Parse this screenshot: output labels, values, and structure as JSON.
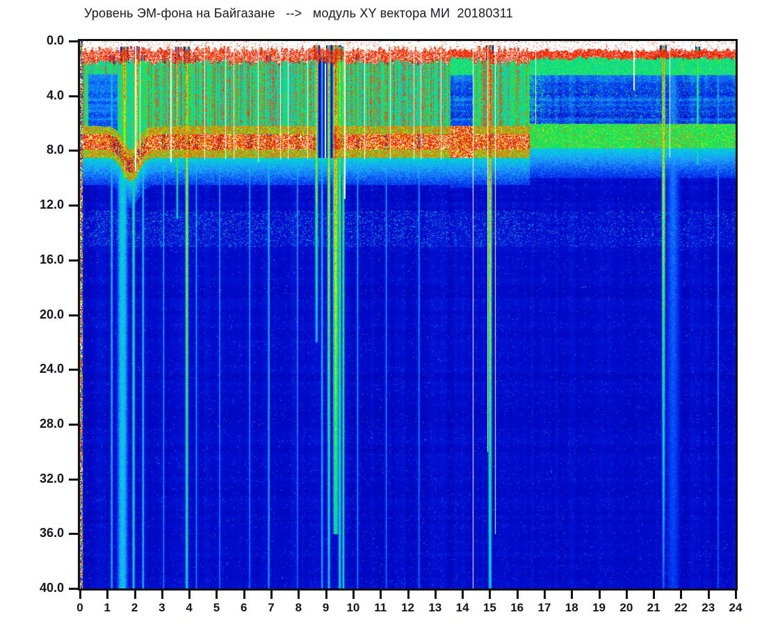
{
  "header": {
    "title": "Уровень ЭМ-фона на Байгазане   -->   модуль XY вектора МИ  20180311"
  },
  "chart_data": {
    "type": "heatmap",
    "title": "Уровень ЭМ-фона на Байгазане   -->   модуль XY вектора МИ  20180311",
    "date": "20180311",
    "station": "Байгазан",
    "quantity": "модуль XY вектора МИ",
    "x_axis": {
      "min": 0,
      "max": 24,
      "unit": "hour",
      "ticks": [
        "0",
        "1",
        "2",
        "3",
        "4",
        "5",
        "6",
        "7",
        "8",
        "9",
        "10",
        "11",
        "12",
        "13",
        "14",
        "15",
        "16",
        "17",
        "18",
        "19",
        "20",
        "21",
        "22",
        "23",
        "24"
      ]
    },
    "y_axis": {
      "min": 0,
      "max": 40,
      "inverted": true,
      "ticks": [
        "0.0",
        "4.0",
        "8.0",
        "12.0",
        "16.0",
        "20.0",
        "24.0",
        "28.0",
        "32.0",
        "36.0",
        "40.0"
      ]
    },
    "colors": {
      "background": "#ffffff",
      "frame": "#101010",
      "label": "#14141f",
      "deep_blue": "#000ac8",
      "cyan": "#00d0e4",
      "green": "#40e828",
      "yellow": "#ffe800",
      "red": "#ff3810"
    },
    "palette_stops": [
      [
        0.0,
        [
          0,
          0,
          168
        ]
      ],
      [
        0.06,
        [
          0,
          12,
          204
        ]
      ],
      [
        0.14,
        [
          0,
          64,
          246
        ]
      ],
      [
        0.22,
        [
          36,
          144,
          255
        ]
      ],
      [
        0.3,
        [
          0,
          208,
          228
        ]
      ],
      [
        0.4,
        [
          0,
          226,
          120
        ]
      ],
      [
        0.5,
        [
          64,
          232,
          40
        ]
      ],
      [
        0.6,
        [
          184,
          236,
          0
        ]
      ],
      [
        0.68,
        [
          255,
          232,
          0
        ]
      ],
      [
        0.76,
        [
          255,
          148,
          0
        ]
      ],
      [
        0.84,
        [
          255,
          56,
          16
        ]
      ],
      [
        1.0,
        [
          214,
          0,
          0
        ]
      ]
    ],
    "structure": {
      "regions": [
        {
          "t0": 0.0,
          "t1": 13.55,
          "mode": "active"
        },
        {
          "t0": 13.55,
          "t1": 14.38,
          "mode": "quiet"
        },
        {
          "t0": 14.38,
          "t1": 15.7,
          "mode": "active"
        },
        {
          "t0": 15.7,
          "t1": 16.45,
          "mode": "active_fading"
        },
        {
          "t0": 16.45,
          "t1": 24.01,
          "mode": "quiet"
        }
      ],
      "sparse_zones": [
        [
          8.62,
          9.26
        ]
      ],
      "blue_patches": [
        {
          "t0": 0.3,
          "t1": 1.35,
          "d0": 2.4,
          "d1": 6.6
        }
      ],
      "band": {
        "active_center": 7.35,
        "active_halfwidth": 1.15,
        "dip_center_t": 1.85,
        "dip_amount": 1.7,
        "dip_sigma": 0.4,
        "quiet_center": 6.9,
        "quiet_halfwidth": 0.9,
        "quiet_fleck_zones": [
          [
            20.3,
            22.4
          ]
        ]
      },
      "red_stripe_zones": [
        [
          0.1,
          1.4,
          0.18
        ],
        [
          2.35,
          8.6,
          0.42
        ],
        [
          9.7,
          13.5,
          0.4
        ],
        [
          14.45,
          15.65,
          0.5
        ],
        [
          15.65,
          16.4,
          0.22
        ]
      ],
      "speckle_band": {
        "d0": 12.4,
        "d1": 15.0,
        "chance_active": 0.09,
        "chance_quiet": 0.05
      },
      "deep_streaks": [
        [
          1.15,
          0.045,
          1.0,
          40,
          0.3,
          0.26
        ],
        [
          1.55,
          0.2,
          1.5,
          40,
          0.33,
          0.29
        ],
        [
          1.62,
          0.07,
          0.4,
          10,
          0.86,
          0.55
        ],
        [
          1.95,
          0.05,
          2.0,
          40,
          0.46,
          0.33
        ],
        [
          2.08,
          0.05,
          0.4,
          10,
          0.85,
          0.5
        ],
        [
          2.3,
          0.04,
          1.0,
          40,
          0.34,
          0.3
        ],
        [
          3.05,
          0.03,
          1.0,
          40,
          0.3,
          0.22
        ],
        [
          3.55,
          0.035,
          0.4,
          13,
          0.82,
          0.4
        ],
        [
          3.9,
          0.05,
          0.4,
          40,
          0.75,
          0.37
        ],
        [
          4.25,
          0.03,
          1.0,
          40,
          0.3,
          0.23
        ],
        [
          5.1,
          0.03,
          1.5,
          40,
          0.27,
          0.2
        ],
        [
          6.2,
          0.03,
          1.5,
          40,
          0.27,
          0.2
        ],
        [
          6.9,
          0.04,
          1.0,
          40,
          0.31,
          0.25
        ],
        [
          7.95,
          0.03,
          1.5,
          40,
          0.27,
          0.2
        ],
        [
          8.65,
          0.05,
          0.3,
          22,
          0.85,
          0.3
        ],
        [
          8.85,
          0.04,
          1.0,
          40,
          0.31,
          0.26
        ],
        [
          9.1,
          0.05,
          0.3,
          40,
          0.8,
          0.3
        ],
        [
          9.35,
          0.09,
          0.3,
          36,
          0.88,
          0.42
        ],
        [
          9.5,
          0.05,
          0.4,
          40,
          0.62,
          0.34
        ],
        [
          9.63,
          0.04,
          0.4,
          40,
          0.56,
          0.4
        ],
        [
          10.15,
          0.03,
          1.0,
          40,
          0.29,
          0.22
        ],
        [
          11.2,
          0.03,
          1.5,
          40,
          0.27,
          0.2
        ],
        [
          12.4,
          0.03,
          1.5,
          40,
          0.27,
          0.2
        ],
        [
          15.0,
          0.06,
          0.3,
          40,
          0.9,
          0.34
        ],
        [
          21.35,
          0.055,
          0.3,
          40,
          0.85,
          0.18
        ],
        [
          21.7,
          0.28,
          1.0,
          40,
          0.2,
          0.13
        ],
        [
          22.6,
          0.04,
          0.4,
          9,
          0.55,
          0.4
        ],
        [
          23.35,
          0.03,
          1.0,
          40,
          0.26,
          0.18
        ]
      ],
      "dropouts": [
        [
          2.02,
          0.035,
          0.2,
          9.5
        ],
        [
          2.18,
          0.025,
          0.2,
          9.0
        ],
        [
          3.32,
          0.03,
          0.2,
          8.8
        ],
        [
          4.55,
          0.025,
          0.2,
          8.6
        ],
        [
          5.32,
          0.025,
          0.2,
          8.6
        ],
        [
          5.62,
          0.025,
          0.2,
          8.6
        ],
        [
          6.52,
          0.03,
          0.2,
          8.8
        ],
        [
          7.32,
          0.025,
          0.2,
          8.6
        ],
        [
          7.62,
          0.025,
          0.2,
          8.6
        ],
        [
          8.32,
          0.025,
          0.2,
          8.6
        ],
        [
          9.68,
          0.05,
          0.2,
          11.5
        ],
        [
          10.42,
          0.025,
          0.2,
          8.6
        ],
        [
          11.35,
          0.025,
          0.2,
          8.6
        ],
        [
          12.22,
          0.025,
          0.2,
          8.6
        ],
        [
          12.48,
          0.025,
          0.2,
          8.6
        ],
        [
          13.2,
          0.025,
          0.2,
          8.6
        ],
        [
          14.38,
          0.03,
          0.2,
          40
        ],
        [
          14.92,
          0.025,
          0.2,
          30
        ],
        [
          15.2,
          0.022,
          0.2,
          36
        ],
        [
          16.66,
          0.022,
          0.3,
          6
        ],
        [
          19.38,
          0.02,
          0.3,
          3
        ],
        [
          20.27,
          0.04,
          0.3,
          3.6
        ],
        [
          21.58,
          0.035,
          0.3,
          8.5
        ]
      ],
      "edge_column_width_hr": 0.08
    }
  }
}
